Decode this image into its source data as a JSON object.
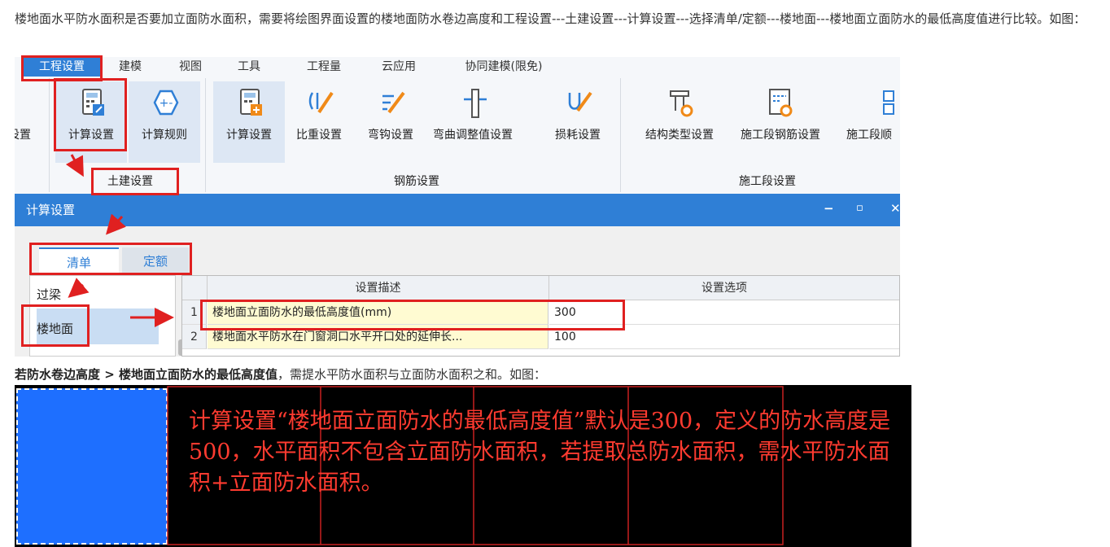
{
  "text": {
    "para1": "楼地面水平防水面积是否要加立面防水面积，需要将绘图界面设置的楼地面防水卷边高度和工程设置---土建设置---计算设置---选择清单/定额---楼地面---楼地面立面防水的最低高度值进行比较。如图：",
    "para2_bold": "若防水卷边高度 > 楼地面立面防水的最低高度值",
    "para2_rest": "，需提水平防水面积与立面防水面积之和。如图："
  },
  "ribbon": {
    "menu": [
      "工程设置",
      "建模",
      "视图",
      "工具",
      "工程量",
      "云应用",
      "协同建模(限免)"
    ],
    "partial_left_label": "设置",
    "tools": {
      "calc_settings": "计算设置",
      "calc_rules": "计算规则",
      "rebar_calc_settings": "计算设置",
      "specific_gravity": "比重设置",
      "hook": "弯钩设置",
      "bend_adjust": "弯曲调整值设置",
      "loss": "损耗设置",
      "struct_type": "结构类型设置",
      "stage_rebar": "施工段钢筋设置",
      "stage_order": "施工段顺"
    },
    "groups": {
      "civil": "土建设置",
      "rebar": "钢筋设置",
      "stage": "施工段设置"
    }
  },
  "dialog": {
    "title": "计算设置",
    "tabs": [
      "清单",
      "定额"
    ],
    "left_list": [
      "过梁",
      "楼地面"
    ],
    "grid": {
      "headers": [
        "设置描述",
        "设置选项"
      ],
      "rows": [
        {
          "no": "1",
          "desc": "楼地面立面防水的最低高度值(mm)",
          "value": "300"
        },
        {
          "no": "2",
          "desc": "楼地面水平防水在门窗洞口水平开口处的延伸长...",
          "value": "100"
        }
      ]
    }
  },
  "annotation": "计算设置“楼地面立面防水的最低高度值”默认是300，定义的防水高度是500，水平面积不包含立面防水面积，若提取总防水面积，需水平防水面积+立面防水面积。",
  "colors": {
    "accent_blue": "#2f7fd6",
    "highlight_red": "#e02020",
    "annotation_red": "#ff3b30",
    "canvas_blue": "#1e6fff"
  }
}
